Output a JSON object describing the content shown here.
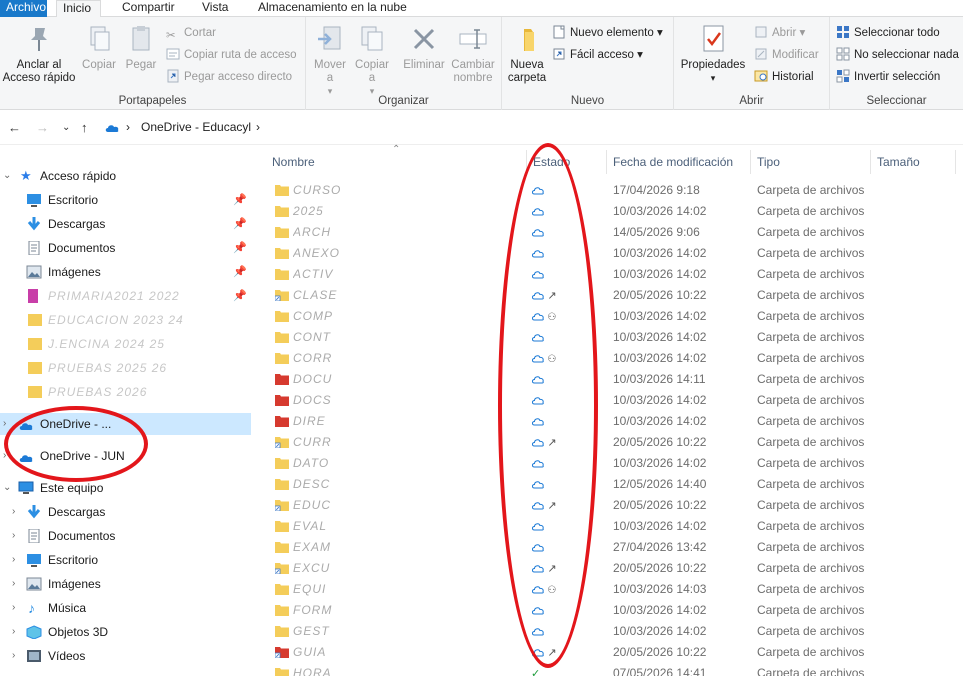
{
  "ribbon": {
    "tabs": [
      "Archivo",
      "Inicio",
      "Compartir",
      "Vista",
      "Almacenamiento en la nube"
    ],
    "groups": {
      "portapapeles": {
        "label": "Portapapeles",
        "anclar": "Anclar al Acceso rápido",
        "copiar": "Copiar",
        "pegar": "Pegar",
        "cortar": "Cortar",
        "copiar_ruta": "Copiar ruta de acceso",
        "pegar_acceso": "Pegar acceso directo"
      },
      "organizar": {
        "label": "Organizar",
        "mover": "Mover a",
        "copiar_a": "Copiar a",
        "eliminar": "Eliminar",
        "cambiar": "Cambiar nombre"
      },
      "nuevo": {
        "label": "Nuevo",
        "nueva_carpeta": "Nueva carpeta",
        "nuevo_elemento": "Nuevo elemento",
        "facil_acceso": "Fácil acceso"
      },
      "abrir": {
        "label": "Abrir",
        "propiedades": "Propiedades",
        "abrir": "Abrir",
        "modificar": "Modificar",
        "historial": "Historial"
      },
      "seleccionar": {
        "label": "Seleccionar",
        "todo": "Seleccionar todo",
        "nada": "No seleccionar nada",
        "invertir": "Invertir selección"
      }
    }
  },
  "address": {
    "path": "OneDrive - Educacyl"
  },
  "nav": {
    "acceso_rapido": "Acceso rápido",
    "quick_items": [
      "Escritorio",
      "Descargas",
      "Documentos",
      "Imágenes"
    ],
    "blurred_items": [
      "PRIMARIA2021 2022",
      "EDUCACION 2023 24",
      "J.ENCINA 2024 25",
      "PRUEBAS 2025 26",
      "PRUEBAS 2026"
    ],
    "onedrive1": "OneDrive - ...",
    "onedrive2": "OneDrive - JUN",
    "este_equipo": "Este equipo",
    "pc_items": [
      "Descargas",
      "Documentos",
      "Escritorio",
      "Imágenes",
      "Música",
      "Objetos 3D",
      "Vídeos"
    ]
  },
  "columns": {
    "nombre": "Nombre",
    "estado": "Estado",
    "fecha": "Fecha de modificación",
    "tipo": "Tipo",
    "tamano": "Tamaño"
  },
  "rows": [
    {
      "name": "CURSO",
      "icon": "folder",
      "status": "cloud",
      "date": "17/04/2026 9:18",
      "type": "Carpeta de archivos"
    },
    {
      "name": "2025",
      "icon": "folder",
      "status": "cloud",
      "date": "10/03/2026 14:02",
      "type": "Carpeta de archivos"
    },
    {
      "name": "ARCH",
      "icon": "folder",
      "status": "cloud",
      "date": "14/05/2026 9:06",
      "type": "Carpeta de archivos"
    },
    {
      "name": "ANEXO",
      "icon": "folder",
      "status": "cloud",
      "date": "10/03/2026 14:02",
      "type": "Carpeta de archivos"
    },
    {
      "name": "ACTIV",
      "icon": "folder",
      "status": "cloud",
      "date": "10/03/2026 14:02",
      "type": "Carpeta de archivos"
    },
    {
      "name": "CLASE",
      "icon": "folder-link",
      "status": "cloud-shortcut",
      "date": "20/05/2026 10:22",
      "type": "Carpeta de archivos"
    },
    {
      "name": "COMP",
      "icon": "folder",
      "status": "cloud-shared",
      "date": "10/03/2026 14:02",
      "type": "Carpeta de archivos"
    },
    {
      "name": "CONT",
      "icon": "folder",
      "status": "cloud",
      "date": "10/03/2026 14:02",
      "type": "Carpeta de archivos"
    },
    {
      "name": "CORR",
      "icon": "folder",
      "status": "cloud-shared",
      "date": "10/03/2026 14:02",
      "type": "Carpeta de archivos"
    },
    {
      "name": "DOCU",
      "icon": "red",
      "status": "cloud",
      "date": "10/03/2026 14:11",
      "type": "Carpeta de archivos"
    },
    {
      "name": "DOCS",
      "icon": "red",
      "status": "cloud",
      "date": "10/03/2026 14:02",
      "type": "Carpeta de archivos"
    },
    {
      "name": "DIRE",
      "icon": "red",
      "status": "cloud",
      "date": "10/03/2026 14:02",
      "type": "Carpeta de archivos"
    },
    {
      "name": "CURR",
      "icon": "folder-link",
      "status": "cloud-shortcut",
      "date": "20/05/2026 10:22",
      "type": "Carpeta de archivos"
    },
    {
      "name": "DATO",
      "icon": "folder",
      "status": "cloud",
      "date": "10/03/2026 14:02",
      "type": "Carpeta de archivos"
    },
    {
      "name": "DESC",
      "icon": "folder",
      "status": "cloud",
      "date": "12/05/2026 14:40",
      "type": "Carpeta de archivos"
    },
    {
      "name": "EDUC",
      "icon": "folder-link",
      "status": "cloud-shortcut",
      "date": "20/05/2026 10:22",
      "type": "Carpeta de archivos"
    },
    {
      "name": "EVAL",
      "icon": "folder",
      "status": "cloud",
      "date": "10/03/2026 14:02",
      "type": "Carpeta de archivos"
    },
    {
      "name": "EXAM",
      "icon": "folder",
      "status": "cloud",
      "date": "27/04/2026 13:42",
      "type": "Carpeta de archivos"
    },
    {
      "name": "EXCU",
      "icon": "folder-link",
      "status": "cloud-shortcut",
      "date": "20/05/2026 10:22",
      "type": "Carpeta de archivos"
    },
    {
      "name": "EQUI",
      "icon": "folder",
      "status": "cloud-shared",
      "date": "10/03/2026 14:03",
      "type": "Carpeta de archivos"
    },
    {
      "name": "FORM",
      "icon": "folder",
      "status": "cloud",
      "date": "10/03/2026 14:02",
      "type": "Carpeta de archivos"
    },
    {
      "name": "GEST",
      "icon": "folder",
      "status": "cloud",
      "date": "10/03/2026 14:02",
      "type": "Carpeta de archivos"
    },
    {
      "name": "GUIA",
      "icon": "red-link",
      "status": "cloud-shortcut",
      "date": "20/05/2026 10:22",
      "type": "Carpeta de archivos"
    },
    {
      "name": "HORA",
      "icon": "folder",
      "status": "synced",
      "date": "07/05/2026 14:41",
      "type": "Carpeta de archivos"
    }
  ],
  "colors": {
    "accent": "#1979ca",
    "selection": "#cce8ff",
    "cloud": "#1c7ad6",
    "annotation": "#e3161b",
    "folder": "#f4cd5a"
  }
}
